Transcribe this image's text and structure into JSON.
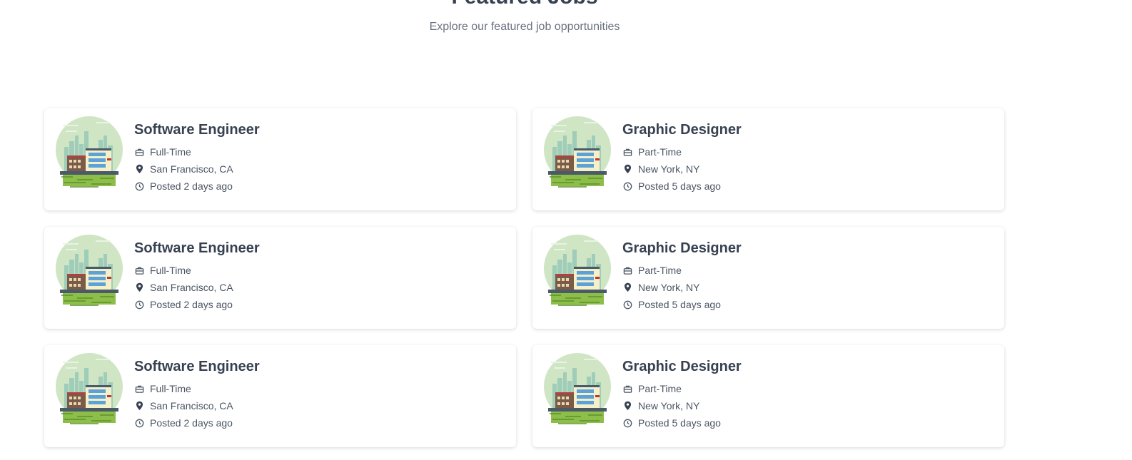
{
  "header": {
    "title": "Featured Jobs",
    "subtitle": "Explore our featured job opportunities"
  },
  "jobs": [
    {
      "title": "Software Engineer",
      "type": "Full-Time",
      "location": "San Francisco, CA",
      "posted": "Posted 2 days ago"
    },
    {
      "title": "Graphic Designer",
      "type": "Part-Time",
      "location": "New York, NY",
      "posted": "Posted 5 days ago"
    },
    {
      "title": "Software Engineer",
      "type": "Full-Time",
      "location": "San Francisco, CA",
      "posted": "Posted 2 days ago"
    },
    {
      "title": "Graphic Designer",
      "type": "Part-Time",
      "location": "New York, NY",
      "posted": "Posted 5 days ago"
    },
    {
      "title": "Software Engineer",
      "type": "Full-Time",
      "location": "San Francisco, CA",
      "posted": "Posted 2 days ago"
    },
    {
      "title": "Graphic Designer",
      "type": "Part-Time",
      "location": "New York, NY",
      "posted": "Posted 5 days ago"
    }
  ],
  "icons": {
    "type": "briefcase-icon",
    "location": "map-pin-icon",
    "posted": "clock-icon"
  },
  "colors": {
    "title": "#374151",
    "subtitle": "#6b7280",
    "meta": "#4b5563"
  }
}
